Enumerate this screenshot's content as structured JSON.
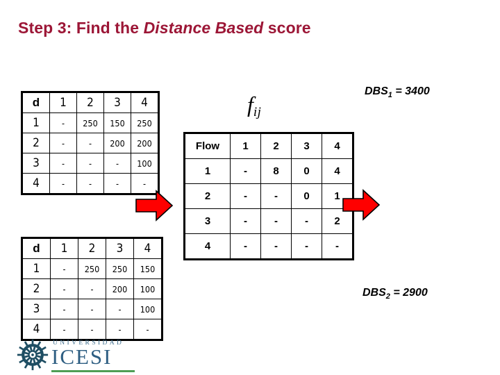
{
  "title": {
    "prefix": "Step 3: Find the ",
    "emphasis": "Distance Based",
    "suffix": " score",
    "color": "#9C1636"
  },
  "labels": {
    "fij_main": "f",
    "fij_sub": "ij",
    "dbs1": "DBS",
    "dbs1_sub": "1",
    "dbs1_value": " = 3400",
    "dbs2": "DBS",
    "dbs2_sub": "2",
    "dbs2_value": " = 2900"
  },
  "distance_table_1": {
    "corner": "d",
    "columns": [
      "1",
      "2",
      "3",
      "4"
    ],
    "rows": [
      {
        "header": "1",
        "cells": [
          "-",
          "250",
          "150",
          "250"
        ]
      },
      {
        "header": "2",
        "cells": [
          "-",
          "-",
          "200",
          "200"
        ]
      },
      {
        "header": "3",
        "cells": [
          "-",
          "-",
          "-",
          "100"
        ]
      },
      {
        "header": "4",
        "cells": [
          "-",
          "-",
          "-",
          "-"
        ]
      }
    ]
  },
  "distance_table_2": {
    "corner": "d",
    "columns": [
      "1",
      "2",
      "3",
      "4"
    ],
    "rows": [
      {
        "header": "1",
        "cells": [
          "-",
          "250",
          "250",
          "150"
        ]
      },
      {
        "header": "2",
        "cells": [
          "-",
          "-",
          "200",
          "100"
        ]
      },
      {
        "header": "3",
        "cells": [
          "-",
          "-",
          "-",
          "100"
        ]
      },
      {
        "header": "4",
        "cells": [
          "-",
          "-",
          "-",
          "-"
        ]
      }
    ]
  },
  "flow_table": {
    "corner": "Flow",
    "columns": [
      "1",
      "2",
      "3",
      "4"
    ],
    "rows": [
      {
        "header": "1",
        "cells": [
          "-",
          "8",
          "0",
          "4"
        ]
      },
      {
        "header": "2",
        "cells": [
          "-",
          "-",
          "0",
          "1"
        ]
      },
      {
        "header": "3",
        "cells": [
          "-",
          "-",
          "-",
          "2"
        ]
      },
      {
        "header": "4",
        "cells": [
          "-",
          "-",
          "-",
          "-"
        ]
      }
    ]
  },
  "arrows": {
    "fill": "#FF0000",
    "stroke": "#000000",
    "left_name": "arrow-right-red-left",
    "right_name": "arrow-right-red-right"
  },
  "logo": {
    "top_text": "UNIVERSIDAD",
    "main_text": "ICESI",
    "mark_color": "#1F4E63",
    "text_color": "#2E5E82",
    "rule_color": "#4E9E55"
  }
}
